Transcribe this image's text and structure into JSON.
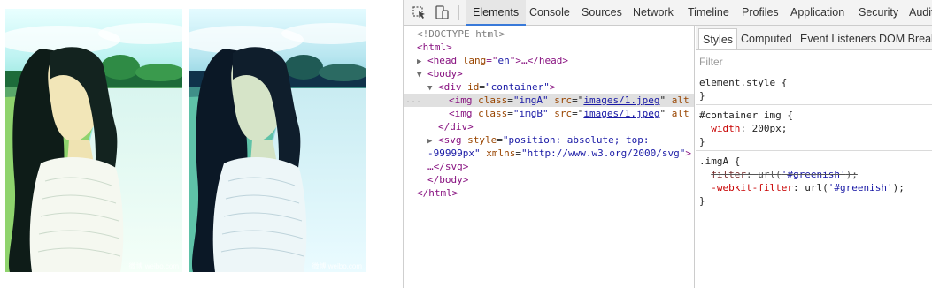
{
  "devtools": {
    "tabs": [
      "Elements",
      "Console",
      "Sources",
      "Network",
      "Timeline",
      "Profiles",
      "Application",
      "Security",
      "Audit"
    ],
    "active_tab": "Elements",
    "sidebar_tabs": [
      "Styles",
      "Computed",
      "Event Listeners",
      "DOM Break"
    ],
    "active_sidebar_tab": "Styles",
    "filter_placeholder": "Filter",
    "dom": {
      "doctype": "<!DOCTYPE html>",
      "html_open": "<html>",
      "head_open": "<head ",
      "head_attr": "lang",
      "head_attr_eq": "=\"",
      "head_attr_val": "en",
      "head_rest": "\">…</head>",
      "body_open": "<body>",
      "div_open": "<div ",
      "div_attr": "id",
      "div_attr_val": "\"container\"",
      "div_close_bracket": ">",
      "imgA_tag": "<img ",
      "imgA_class_attr": "class",
      "imgA_class_val": "\"imgA\"",
      "imgA_src_attr": "src",
      "imgA_src_val": "images/1.jpeg",
      "imgA_alt": "alt",
      "imgB_tag": "<img ",
      "imgB_class_attr": "class",
      "imgB_class_val": "\"imgB\"",
      "imgB_src_attr": "src",
      "imgB_src_val": "images/1.jpeg",
      "imgB_alt": "alt",
      "div_close": "</div>",
      "svg_tag": "<svg ",
      "svg_style_attr": "style",
      "svg_style_val_1": "\"position: absolute; top:",
      "svg_style_val_2": "-99999px\"",
      "svg_xmlns_attr": "xmlns",
      "svg_xmlns_val": "\"http://www.w3.org/2000/svg\"",
      "svg_close_bracket": ">",
      "svg_close": "…</svg>",
      "body_close": "</body>",
      "html_close": "</html>",
      "selected_marker": "..."
    },
    "styles": {
      "element_style": "element.style",
      "container_selector": "#container img",
      "container_prop": "width",
      "container_val": "200px",
      "imgA_selector": ".imgA",
      "filter_prop": "filter",
      "filter_val_prefix": "url(",
      "filter_val_str": "'#greenish'",
      "filter_val_suffix": ");",
      "webkit_prop": "-webkit-filter",
      "webkit_val_prefix": "url(",
      "webkit_val_str": "'#greenish'",
      "webkit_val_suffix": ");"
    }
  },
  "photos": {
    "caption_a": "微博 weibo.com",
    "caption_b": "微博 weibo.com"
  },
  "colors": {
    "accent": "#3879d9",
    "tag": "#881280",
    "attr_name": "#994500",
    "attr_value": "#1a1aa6",
    "css_prop": "#c80000"
  }
}
